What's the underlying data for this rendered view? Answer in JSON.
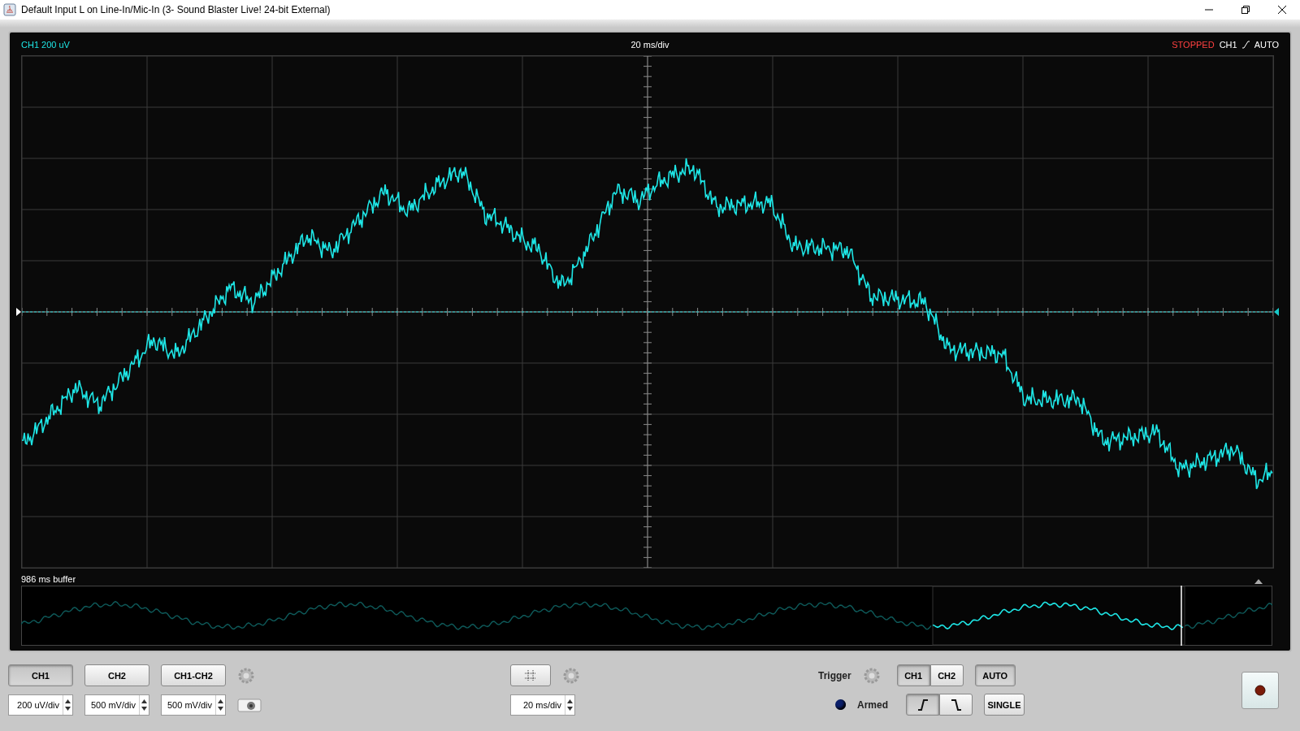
{
  "window": {
    "title": "Default Input L on Line-In/Mic-In (3- Sound Blaster Live! 24-bit External)"
  },
  "scope": {
    "channel_scale": "CH1 200 uV",
    "timebase": "20 ms/div",
    "run_status": "STOPPED",
    "trigger_channel": "CH1",
    "trigger_mode": "AUTO",
    "buffer_label": "986 ms buffer"
  },
  "channel_buttons": [
    {
      "label": "CH1",
      "selected": true
    },
    {
      "label": "CH2",
      "selected": false
    },
    {
      "label": "CH1-CH2",
      "selected": false
    }
  ],
  "volt_fields": [
    {
      "value": "200 uV/div"
    },
    {
      "value": "500 mV/div"
    },
    {
      "value": "500 mV/div"
    }
  ],
  "timebase_field": {
    "value": "20 ms/div"
  },
  "trigger": {
    "label": "Trigger",
    "armed_label": "Armed",
    "armed_on": false,
    "channels": [
      {
        "label": "CH1",
        "selected": true
      },
      {
        "label": "CH2",
        "selected": false
      }
    ],
    "slopes": [
      {
        "kind": "rising",
        "selected": true
      },
      {
        "kind": "falling",
        "selected": false
      }
    ],
    "mode_buttons": [
      {
        "label": "AUTO",
        "selected": true
      },
      {
        "label": "SINGLE",
        "selected": false
      }
    ]
  }
}
